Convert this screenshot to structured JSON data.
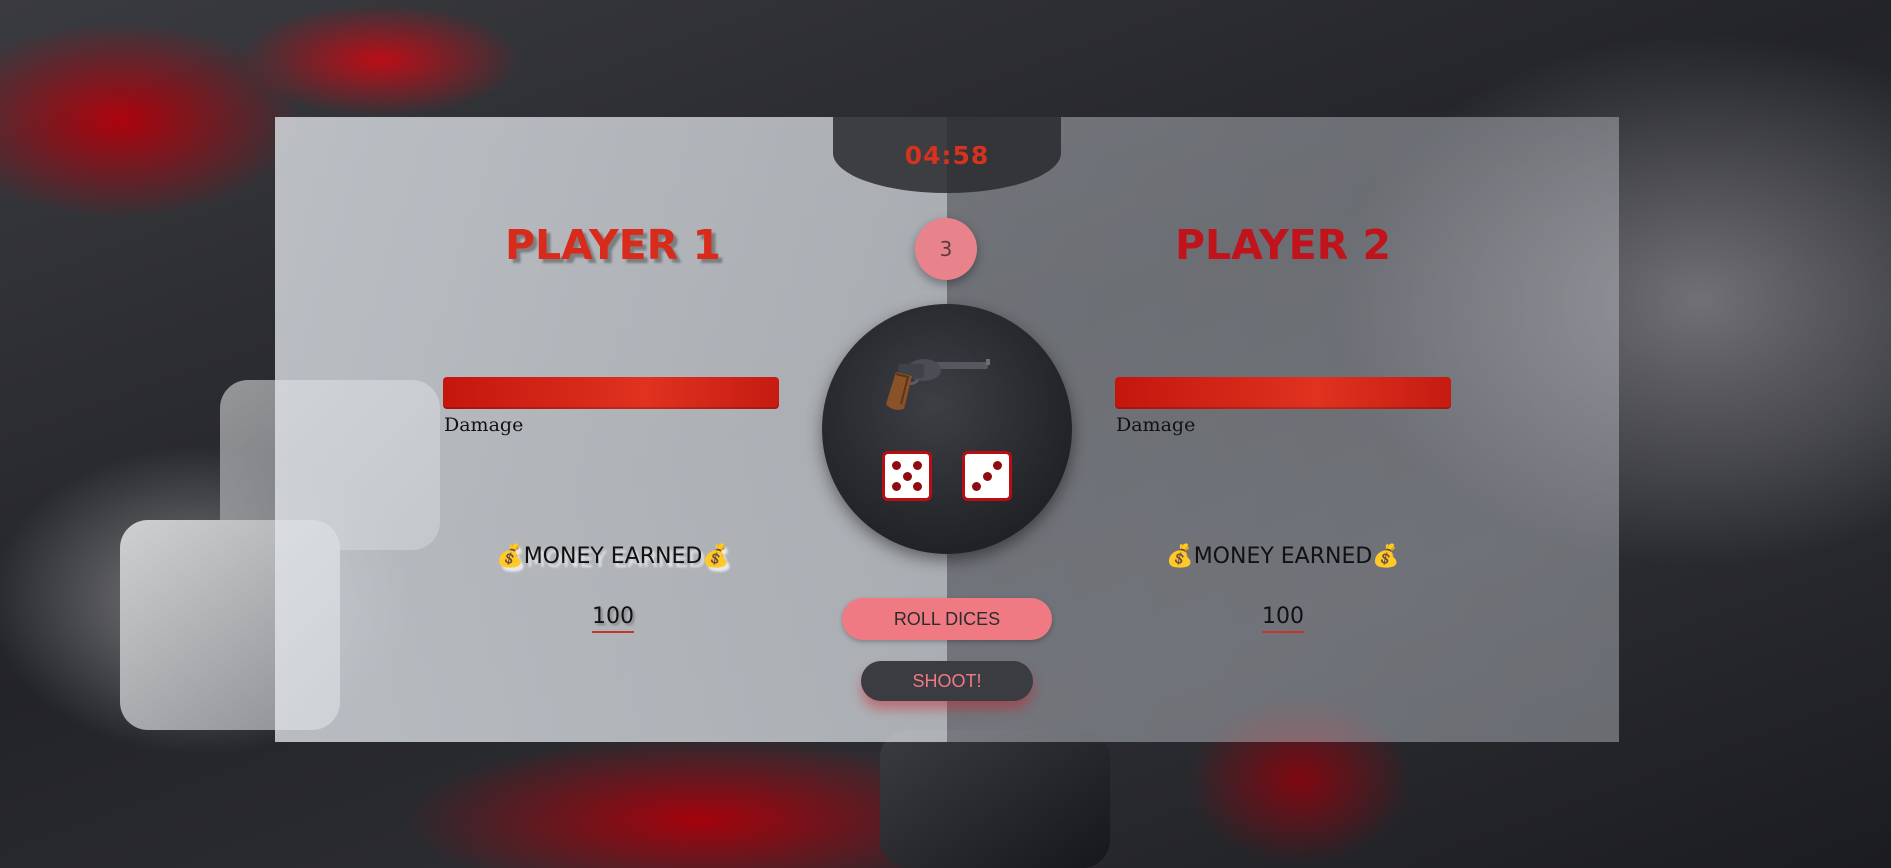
{
  "timer": "04:58",
  "round": "3",
  "players": [
    {
      "name": "PLAYER 1",
      "damage_label": "Damage",
      "damage_fill": 1.0,
      "money_label": "💰MONEY EARNED💰",
      "money": "100"
    },
    {
      "name": "PLAYER 2",
      "damage_label": "Damage",
      "damage_fill": 1.0,
      "money_label": "💰MONEY EARNED💰",
      "money": "100"
    }
  ],
  "dice": [
    5,
    3
  ],
  "buttons": {
    "roll": "ROLL DICES",
    "shoot": "SHOOT!"
  },
  "icons": {
    "weapon": "revolver-icon"
  },
  "colors": {
    "accent": "#d92b1c",
    "bar": "#d0281a",
    "roll_button": "#f07a84",
    "shoot_button": "#3a3c42"
  }
}
